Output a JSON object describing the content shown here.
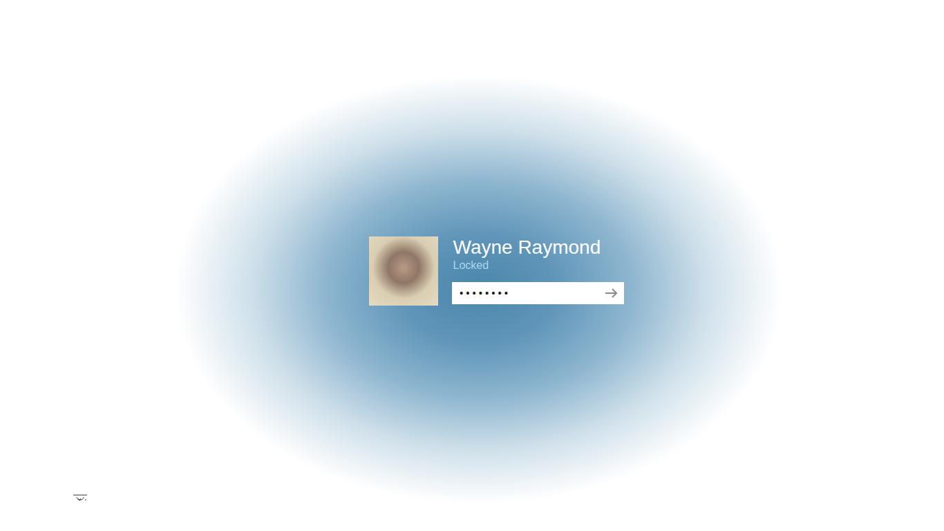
{
  "user": {
    "name": "Wayne Raymond",
    "status": "Locked"
  },
  "password": {
    "value": "••••••••"
  }
}
